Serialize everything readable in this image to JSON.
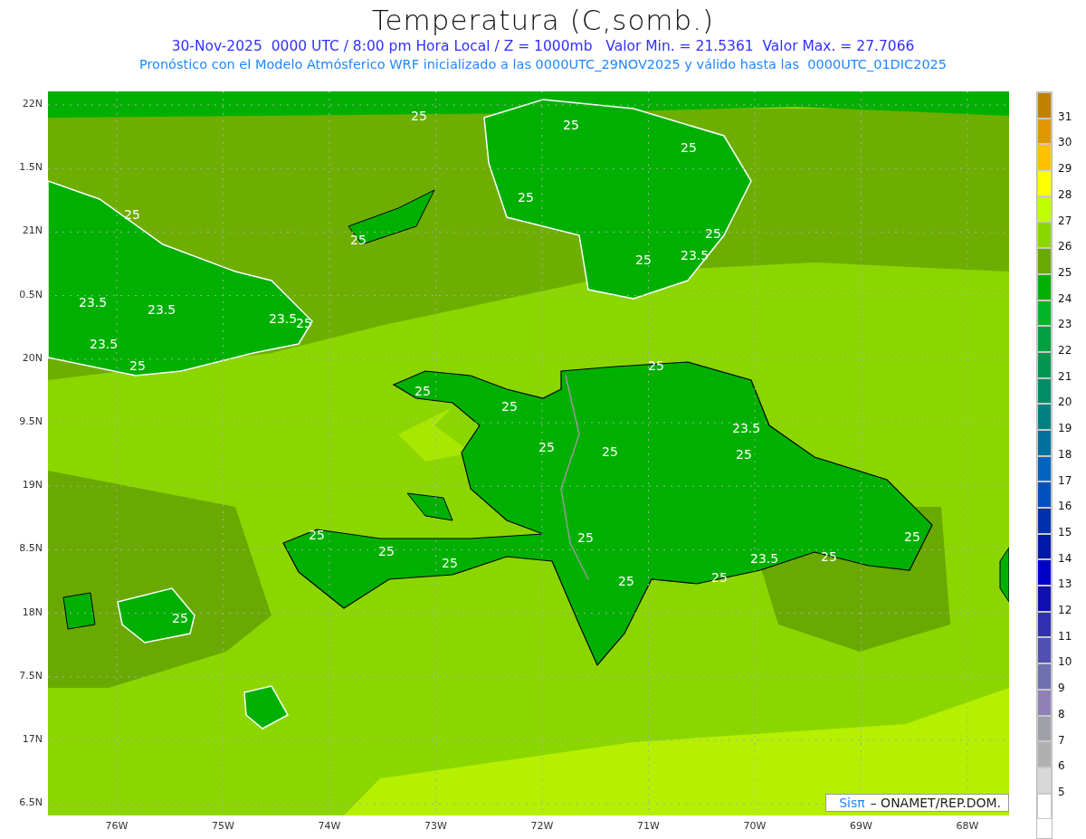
{
  "title": "Temperatura (C,somb.)",
  "subtitle": "30-Nov-2025  0000 UTC / 8:00 pm Hora Local / Z = 1000mb   Valor Min. = 21.5361  Valor Max. = 27.7066",
  "model_line": "Pronóstico con el Modelo Atmósferico WRF inicializado a las 0000UTC_29NOV2025 y válido hasta las  0000UTC_01DIC2025",
  "y_ticks": [
    "22N",
    "1.5N",
    "21N",
    "0.5N",
    "20N",
    "9.5N",
    "19N",
    "8.5N",
    "18N",
    "7.5N",
    "17N",
    "6.5N"
  ],
  "x_ticks": [
    "76W",
    "75W",
    "74W",
    "73W",
    "72W",
    "71W",
    "70W",
    "69W",
    "68W"
  ],
  "contour_labels": [
    "25",
    "25",
    "25",
    "25",
    "25",
    "25",
    "25",
    "25",
    "23.5",
    "23.5",
    "23.5",
    "23.5",
    "25",
    "23.5",
    "25",
    "25",
    "25",
    "25",
    "23.5",
    "25",
    "25",
    "25",
    "25",
    "25",
    "25",
    "25",
    "23.5",
    "25",
    "25",
    "25",
    "25",
    "25"
  ],
  "colorbar": {
    "swatches": [
      {
        "color": "#c08000"
      },
      {
        "color": "#e09800"
      },
      {
        "color": "#ffc000"
      },
      {
        "color": "#ffff00"
      },
      {
        "color": "#c0ff00"
      },
      {
        "color": "#8cd600"
      },
      {
        "color": "#6aaa00"
      },
      {
        "color": "#00b000"
      },
      {
        "color": "#00b428"
      },
      {
        "color": "#00a040"
      },
      {
        "color": "#009650"
      },
      {
        "color": "#008c64"
      },
      {
        "color": "#008080"
      },
      {
        "color": "#00709c"
      },
      {
        "color": "#0064c0"
      },
      {
        "color": "#0050c0"
      },
      {
        "color": "#0030b0"
      },
      {
        "color": "#0018a8"
      },
      {
        "color": "#0000c8"
      },
      {
        "color": "#1010b0"
      },
      {
        "color": "#3030b0"
      },
      {
        "color": "#5050b0"
      },
      {
        "color": "#7070b0"
      },
      {
        "color": "#9080b8"
      },
      {
        "color": "#a0a0a8"
      },
      {
        "color": "#b0b0b0"
      },
      {
        "color": "#d8d8d8"
      },
      {
        "color": "#ffffff"
      }
    ],
    "labels": [
      "31",
      "30",
      "29",
      "28",
      "27",
      "26",
      "25",
      "24",
      "23",
      "22",
      "21",
      "20",
      "19",
      "18",
      "17",
      "16",
      "15",
      "14",
      "13",
      "12",
      "11",
      "10",
      "9",
      "8",
      "7",
      "6",
      "5"
    ]
  },
  "footer": {
    "brand": "Sisπ",
    "text": "– ONAMET/REP.DOM."
  }
}
